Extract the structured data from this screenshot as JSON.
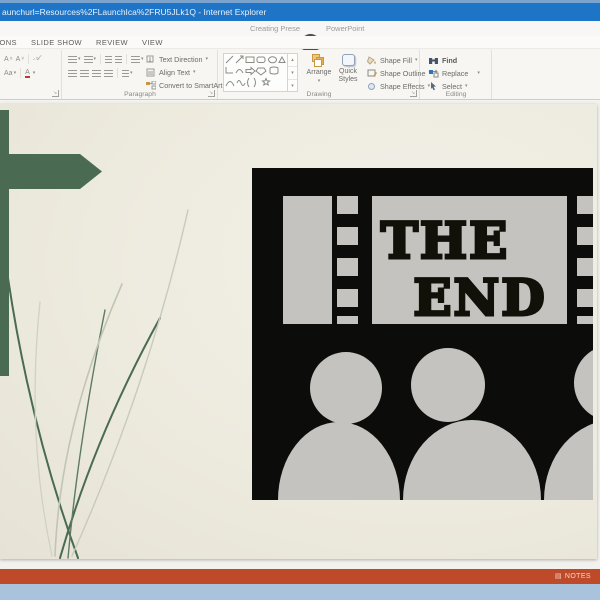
{
  "window": {
    "ie_title": "aunchurl=Resources%2FLaunchIca%2FRU5JLk1Q - Internet Explorer",
    "doc_title": "Creating Prese",
    "app_name": "PowerPoint"
  },
  "ribbon": {
    "tabs": [
      {
        "label": "IONS"
      },
      {
        "label": "SLIDE SHOW"
      },
      {
        "label": "REVIEW"
      },
      {
        "label": "VIEW"
      }
    ],
    "font_group": {
      "grow_font": "A",
      "shrink_font": "A",
      "change_case": "Aa",
      "font_color": "A"
    },
    "paragraph_group": {
      "label": "Paragraph",
      "text_direction": "Text Direction",
      "align_text": "Align Text",
      "convert_smartart": "Convert to SmartArt"
    },
    "drawing_group": {
      "label": "Drawing",
      "arrange": "Arrange",
      "quick_styles": "Quick Styles",
      "shape_fill": "Shape Fill",
      "shape_outline": "Shape Outline",
      "shape_effects": "Shape Effects"
    },
    "editing_group": {
      "label": "Editing",
      "find": "Find",
      "replace": "Replace",
      "select": "Select"
    }
  },
  "slide": {
    "clipart_text_line1": "THE",
    "clipart_text_line2": "END"
  },
  "status_bar": {
    "notes": "NOTES"
  },
  "colors": {
    "titlebar_blue": "#1e74c6",
    "status_red": "#bf4a2a",
    "taskbar_blue": "#a9c3dd",
    "slide_cream": "#edeade",
    "theme_green": "#4a6b52",
    "clipart_black": "#0c0c0a",
    "clipart_gray": "#c4c3c0"
  }
}
